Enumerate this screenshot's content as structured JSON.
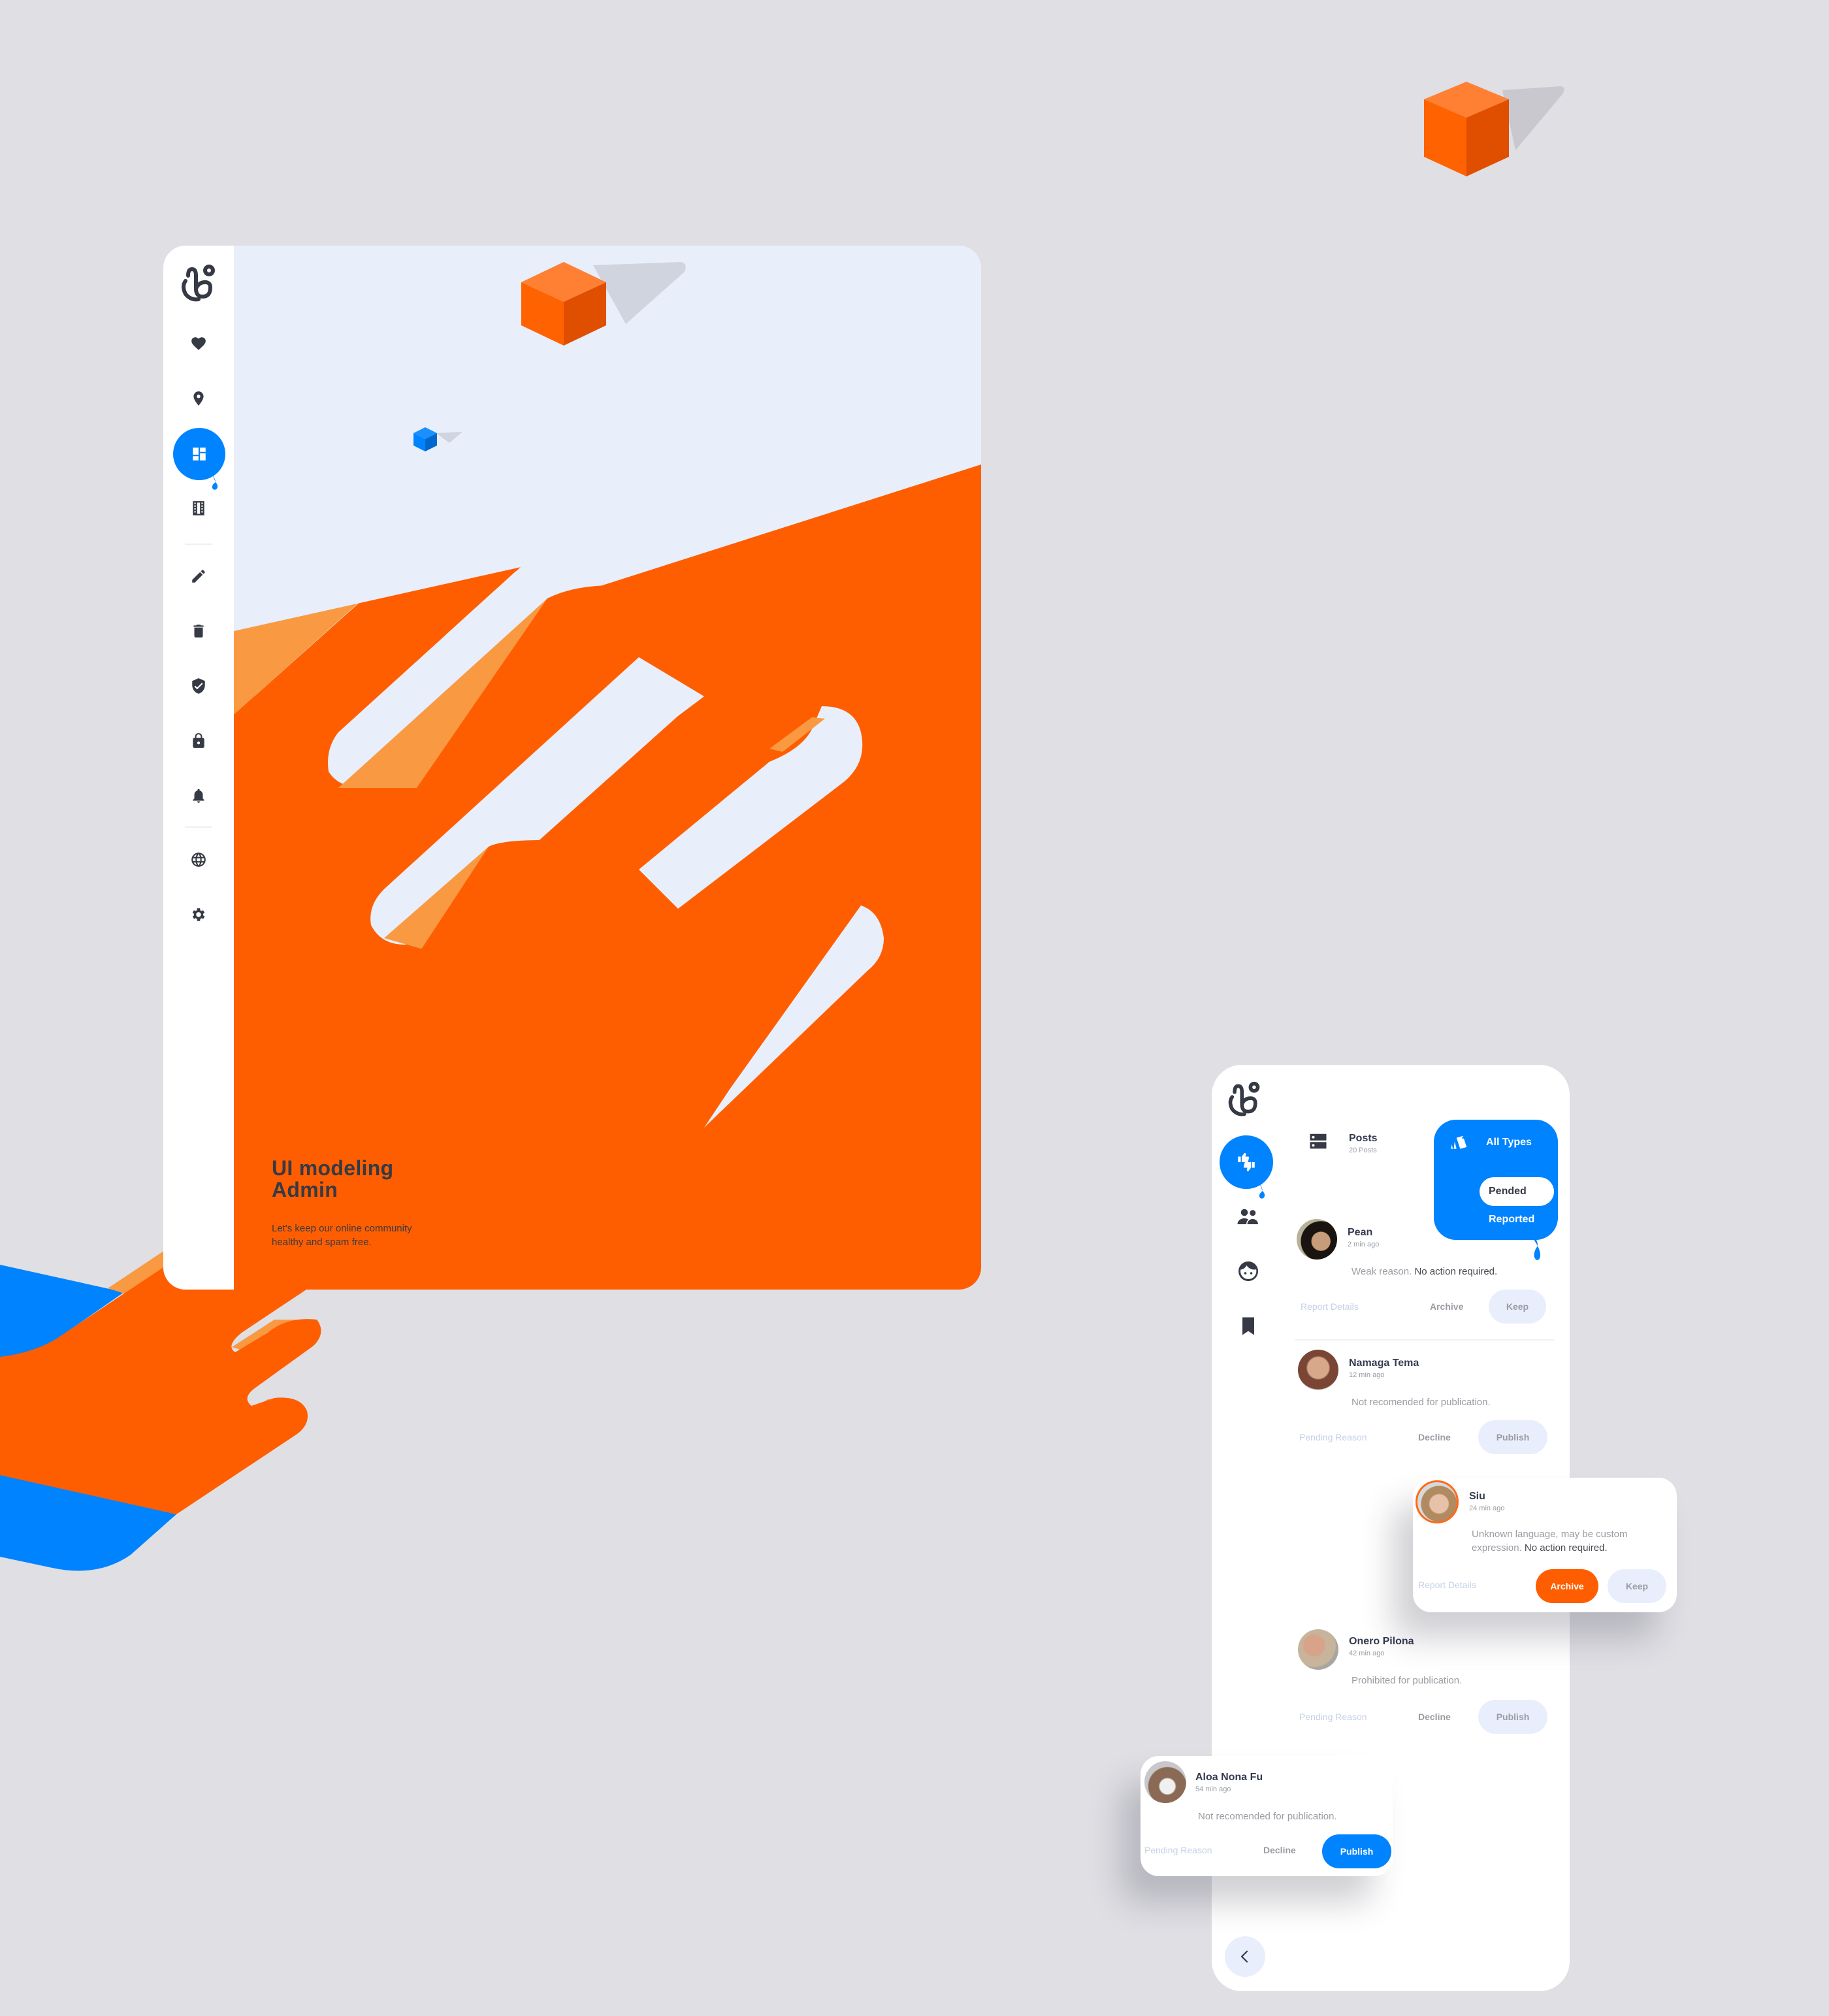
{
  "colors": {
    "background": "#dfdfe4",
    "orange": "#ff5e00",
    "orange_light": "#f99a43",
    "blue": "#0083ff",
    "panel_bg": "#e8eefa",
    "dark": "#353a44"
  },
  "admin": {
    "sidebar": {
      "logo": "brand-logo",
      "items": [
        {
          "icon": "heart-icon",
          "label": "Favorites",
          "active": false
        },
        {
          "icon": "location-pin-icon",
          "label": "Location",
          "active": false
        },
        {
          "icon": "dashboard-icon",
          "label": "Dashboard",
          "active": true
        },
        {
          "icon": "film-icon",
          "label": "Media",
          "active": false
        },
        {
          "icon": "pencil-icon",
          "label": "Edit",
          "active": false
        },
        {
          "icon": "trash-icon",
          "label": "Delete",
          "active": false
        },
        {
          "icon": "shield-check-icon",
          "label": "Security",
          "active": false
        },
        {
          "icon": "lock-icon",
          "label": "Privacy",
          "active": false
        },
        {
          "icon": "bell-icon",
          "label": "Notifications",
          "active": false
        },
        {
          "icon": "globe-icon",
          "label": "Language",
          "active": false
        },
        {
          "icon": "gear-icon",
          "label": "Settings",
          "active": false
        }
      ]
    },
    "hero": {
      "title_line1": "UI modeling",
      "title_line2": "Admin",
      "subtitle_line1": "Let's keep our online community",
      "subtitle_line2": "healthy and spam free."
    }
  },
  "mobile": {
    "sidebar": {
      "items": [
        {
          "icon": "thumbs-up-down-icon",
          "active": true
        },
        {
          "icon": "people-icon",
          "active": false
        },
        {
          "icon": "face-icon",
          "active": false
        },
        {
          "icon": "bookmark-icon",
          "active": false
        }
      ]
    },
    "header": {
      "title": "Posts",
      "count": "20 Posts"
    },
    "filter": {
      "label": "All Types",
      "options": [
        "Pended",
        "Reported"
      ],
      "selected": "Pended"
    },
    "cards": [
      {
        "name": "Pean",
        "time": "2 min ago",
        "message": "Weak reason.",
        "message_emphasis": "No action required.",
        "link": "Report Details",
        "secondary": "Archive",
        "primary": "Keep",
        "highlight": "none"
      },
      {
        "name": "Namaga Tema",
        "time": "12 min ago",
        "message": "Not recomended for publication.",
        "message_emphasis": "",
        "link": "Pending Reason",
        "secondary": "Decline",
        "primary": "Publish",
        "highlight": "none"
      },
      {
        "name": "Siu",
        "time": "24 min ago",
        "message": "Unknown language, may be custom expression.",
        "message_emphasis": "No action required.",
        "link": "Report Details",
        "secondary": "Archive",
        "primary": "Keep",
        "highlight": "archive"
      },
      {
        "name": "Onero Pilona",
        "time": "42 min ago",
        "message": "Prohibited for publication.",
        "message_emphasis": "",
        "link": "Pending Reason",
        "secondary": "Decline",
        "primary": "Publish",
        "highlight": "none"
      },
      {
        "name": "Aloa Nona Fu",
        "time": "54 min ago",
        "message": "Not recomended for publication.",
        "message_emphasis": "",
        "link": "Pending Reason",
        "secondary": "Decline",
        "primary": "Publish",
        "highlight": "publish"
      }
    ],
    "back_button": "chevron-left-icon"
  }
}
